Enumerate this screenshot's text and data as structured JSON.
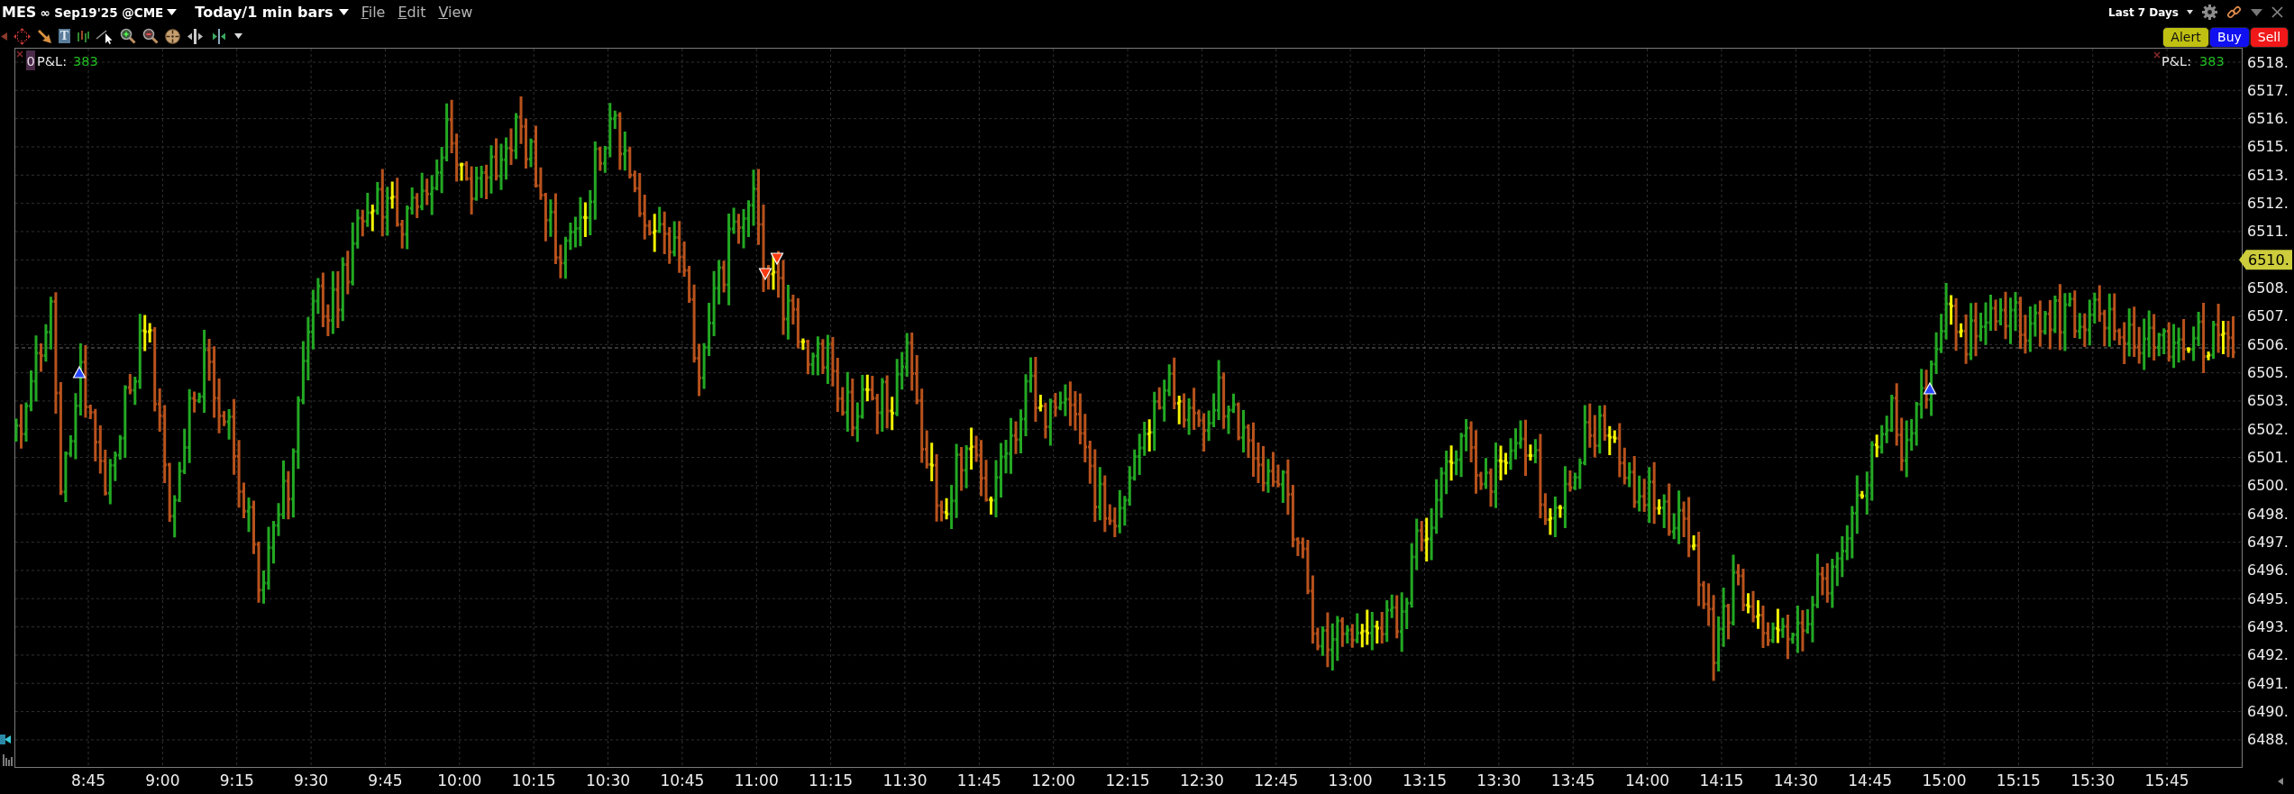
{
  "window": {
    "symbol": "MES",
    "contract": "∞ Sep19'25 @CME",
    "period": "Today/1 min bars",
    "menu": [
      {
        "label": "File"
      },
      {
        "label": "Edit"
      },
      {
        "label": "View"
      }
    ],
    "range": "Last 7 Days"
  },
  "toolbar": {
    "text_tool": "T"
  },
  "order_buttons": [
    {
      "label": "Alert",
      "kind": "alert"
    },
    {
      "label": "Buy",
      "kind": "buy"
    },
    {
      "label": "Sell",
      "kind": "sell"
    }
  ],
  "chart": {
    "pnl_left": {
      "position_count": "0",
      "label": "P&L:",
      "value": "383"
    },
    "pnl_right": {
      "label": "P&L:",
      "value": "383"
    },
    "price_axis": [
      {
        "label": "6518.",
        "kind": "tick"
      },
      {
        "label": "6517.",
        "kind": "tick"
      },
      {
        "label": "6516.",
        "kind": "tick"
      },
      {
        "label": "6515.",
        "kind": "tick"
      },
      {
        "label": "6513.",
        "kind": "tick"
      },
      {
        "label": "6512.",
        "kind": "tick"
      },
      {
        "label": "6511.",
        "kind": "tick"
      },
      {
        "label": "6510.",
        "kind": "tag"
      },
      {
        "label": "6508.",
        "kind": "tick"
      },
      {
        "label": "6507.",
        "kind": "tick"
      },
      {
        "label": "6506.",
        "kind": "tick"
      },
      {
        "label": "6505.",
        "kind": "tick"
      },
      {
        "label": "6503.",
        "kind": "tick"
      },
      {
        "label": "6502.",
        "kind": "tick"
      },
      {
        "label": "6501.",
        "kind": "tick"
      },
      {
        "label": "6500.",
        "kind": "tick"
      },
      {
        "label": "6498.",
        "kind": "tick"
      },
      {
        "label": "6497.",
        "kind": "tick"
      },
      {
        "label": "6496.",
        "kind": "tick"
      },
      {
        "label": "6495.",
        "kind": "tick"
      },
      {
        "label": "6493.",
        "kind": "tick"
      },
      {
        "label": "6492.",
        "kind": "tick"
      },
      {
        "label": "6491.",
        "kind": "tick"
      },
      {
        "label": "6490.",
        "kind": "tick"
      },
      {
        "label": "6488.",
        "kind": "tick"
      }
    ],
    "time_axis": [
      "8:45",
      "9:00",
      "9:15",
      "9:30",
      "9:45",
      "10:00",
      "10:15",
      "10:30",
      "10:45",
      "11:00",
      "11:15",
      "11:30",
      "11:45",
      "12:00",
      "12:15",
      "12:30",
      "12:45",
      "13:00",
      "13:15",
      "13:30",
      "13:45",
      "14:00",
      "14:15",
      "14:30",
      "14:45",
      "15:00",
      "15:15",
      "15:30",
      "15:45"
    ],
    "executions": [
      {
        "kind": "buy"
      },
      {
        "kind": "sell"
      },
      {
        "kind": "sell"
      },
      {
        "kind": "buy"
      }
    ]
  }
}
